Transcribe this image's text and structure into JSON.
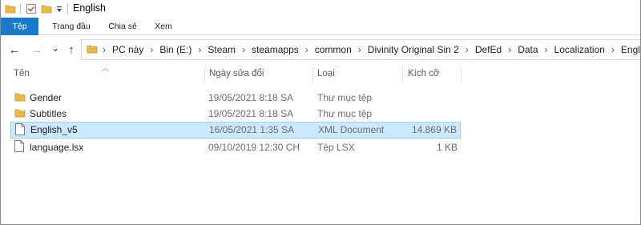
{
  "window": {
    "title": "English"
  },
  "quick_access": [
    {
      "icon": "folder-icon"
    },
    {
      "icon": "properties-check-icon"
    },
    {
      "icon": "new-folder-icon"
    },
    {
      "icon": "customize-dropdown-icon"
    }
  ],
  "ribbon": {
    "tabs": [
      {
        "label": "Tệp"
      },
      {
        "label": "Trang đầu"
      },
      {
        "label": "Chia sẻ"
      },
      {
        "label": "Xem"
      }
    ]
  },
  "navigation": {
    "back": "←",
    "forward": "→",
    "recent": "⌄",
    "up": "↑"
  },
  "address": {
    "crumbs": [
      "PC này",
      "Bin (E:)",
      "Steam",
      "steamapps",
      "common",
      "Divinity Original Sin 2",
      "DefEd",
      "Data",
      "Localization",
      "English"
    ]
  },
  "columns": {
    "name": "Tên",
    "date": "Ngày sửa đổi",
    "type": "Loại",
    "size": "Kích cỡ"
  },
  "files": [
    {
      "name": "Gender",
      "date": "19/05/2021 8:18 SA",
      "type": "Thư mục tệp",
      "size": "",
      "icon": "folder-icon",
      "selected": false
    },
    {
      "name": "Subtitles",
      "date": "19/05/2021 8:18 SA",
      "type": "Thư mục tệp",
      "size": "",
      "icon": "folder-icon",
      "selected": false
    },
    {
      "name": "English_v5",
      "date": "16/05/2021 1:35 SA",
      "type": "XML Document",
      "size": "14.869 KB",
      "icon": "document-icon",
      "selected": true
    },
    {
      "name": "language.lsx",
      "date": "09/10/2019 12:30 CH",
      "type": "Tệp LSX",
      "size": "1 KB",
      "icon": "document-icon",
      "selected": false
    }
  ],
  "colors": {
    "file_tab": "#1979ca",
    "selection": "#cce8ff",
    "folder": "#e8b945"
  }
}
